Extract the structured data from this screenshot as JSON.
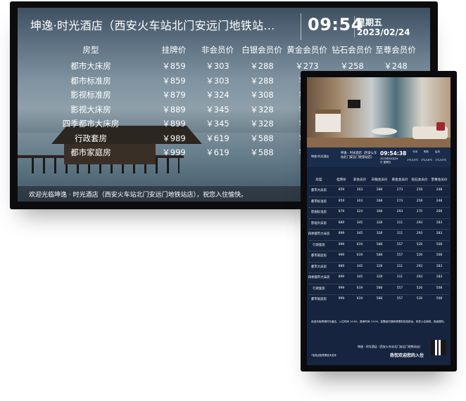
{
  "tv": {
    "title": "坤逸·时光酒店（西安火车站北门安远门地铁站...",
    "time": "09:54",
    "weekday": "星期五",
    "date": "2023/02/24",
    "columns": [
      "房型",
      "挂牌价",
      "非会员价",
      "白银会员价",
      "黄金会员价",
      "钻石会员价",
      "至尊会员价"
    ],
    "rows": [
      [
        "都市大床房",
        "￥859",
        "￥303",
        "￥288",
        "￥273",
        "￥258",
        "￥248"
      ],
      [
        "都市标准房",
        "￥859",
        "￥303",
        "￥288",
        "￥27",
        "",
        ""
      ],
      [
        "影视标准房",
        "￥879",
        "￥324",
        "￥308",
        "￥29",
        "",
        ""
      ],
      [
        "影视大床房",
        "￥889",
        "￥345",
        "￥328",
        "￥31",
        "",
        ""
      ],
      [
        "四季都市大床房",
        "￥899",
        "￥345",
        "￥328",
        "￥31",
        "",
        ""
      ],
      [
        "行政套房",
        "￥989",
        "￥619",
        "￥588",
        "￥55",
        "",
        ""
      ],
      [
        "都市家庭房",
        "￥999",
        "￥619",
        "￥588",
        "￥55",
        "",
        ""
      ]
    ],
    "footer": "欢迎光临坤逸 · 时光酒店（西安火车站北门安远门地铁站店），祝您入住愉快。"
  },
  "kiosk": {
    "logo": "坤逸·时光酒店",
    "hotel_name": "坤逸 · 时光酒店（西安火车站北门安远门地铁站店）",
    "time": "09:54:38",
    "date": "2023年02月24日 星期五",
    "weather_labels": [
      "今天",
      "明天",
      "后天"
    ],
    "temps": [
      "1℃/15℃",
      "1℃/16℃",
      "1℃/15℃"
    ],
    "columns": [
      "房型",
      "挂牌价",
      "非会员价",
      "白银会员价",
      "黄金会员价",
      "钻石会员价",
      "至尊会员价"
    ],
    "rows": [
      [
        "都市大床房",
        "859",
        "303",
        "288",
        "273",
        "258",
        "248"
      ],
      [
        "都市标准房",
        "859",
        "303",
        "288",
        "273",
        "258",
        "248"
      ],
      [
        "影视标准房",
        "879",
        "324",
        "308",
        "293",
        "275",
        "266"
      ],
      [
        "影视大床房",
        "889",
        "345",
        "328",
        "311",
        "293",
        "283"
      ],
      [
        "四季都市大床房",
        "899",
        "345",
        "328",
        "311",
        "293",
        "283"
      ],
      [
        "行政套房",
        "999",
        "619",
        "588",
        "557",
        "526",
        "508"
      ],
      [
        "都市家庭房",
        "999",
        "619",
        "588",
        "557",
        "526",
        "508"
      ],
      [
        "都市大床房",
        "889",
        "345",
        "328",
        "311",
        "293",
        "283"
      ],
      [
        "四季都市大床房",
        "899",
        "345",
        "328",
        "311",
        "293",
        "283"
      ],
      [
        "行政套房",
        "999",
        "619",
        "588",
        "557",
        "526",
        "508"
      ],
      [
        "都市家庭房",
        "999",
        "619",
        "588",
        "557",
        "526",
        "508"
      ]
    ],
    "notice": "欢迎光临坤逸时光酒店，入住时间 14:00，退房时间 12:00，如需延时退房请提前告知前台，祝您入住愉快，旅途顺利。",
    "footer_name": "坤逸 · 时光酒店（西安火车站北门安远门地铁站店）",
    "welcome": "热忱欢迎您的入住",
    "brand": "*信息由智慧屏技术支持"
  }
}
